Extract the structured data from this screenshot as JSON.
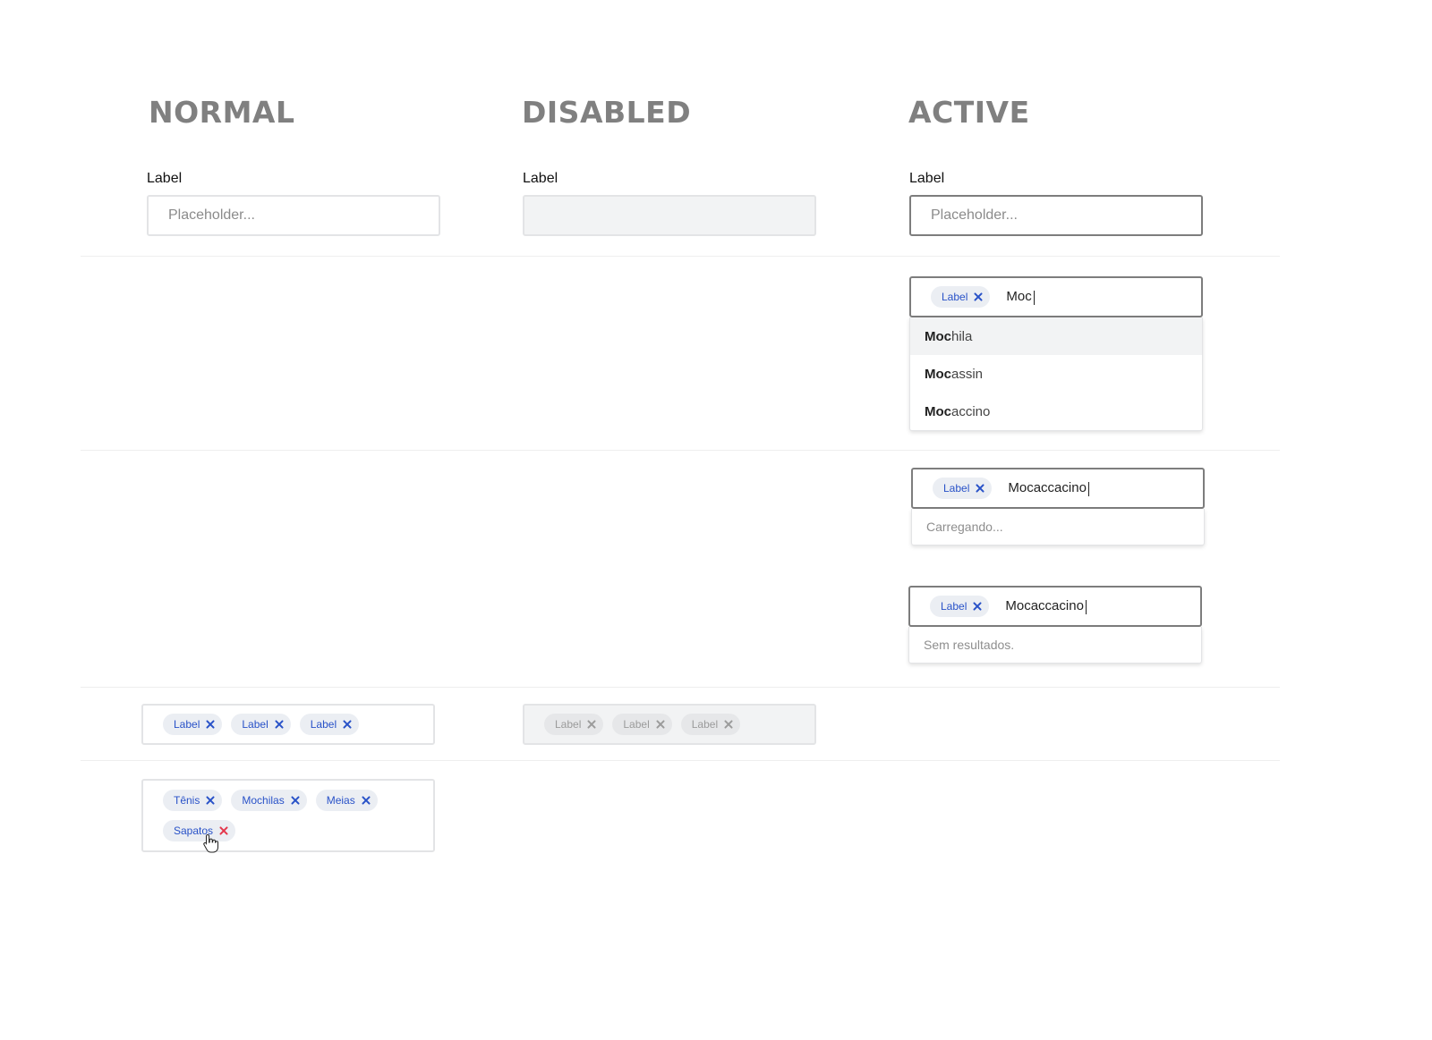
{
  "headings": {
    "normal": "NORMAL",
    "disabled": "DISABLED",
    "active": "ACTIVE"
  },
  "fields": {
    "normal": {
      "label": "Label",
      "placeholder": "Placeholder..."
    },
    "disabled": {
      "label": "Label",
      "placeholder": ""
    },
    "active": {
      "label": "Label",
      "placeholder": "Placeholder..."
    }
  },
  "autocomplete": {
    "chip": "Label",
    "typed": "Moc",
    "match": "Moc",
    "options": [
      {
        "match": "Moc",
        "rest": "hila"
      },
      {
        "match": "Moc",
        "rest": "assin"
      },
      {
        "match": "Moc",
        "rest": "accino"
      }
    ]
  },
  "loading": {
    "chip": "Label",
    "typed": "Mocaccacino",
    "status": "Carregando..."
  },
  "no_results": {
    "chip": "Label",
    "typed": "Mocaccacino",
    "status": "Sem resultados."
  },
  "tags_normal": [
    "Label",
    "Label",
    "Label"
  ],
  "tags_disabled": [
    "Label",
    "Label",
    "Label"
  ],
  "tags_multi": [
    "Tênis",
    "Mochilas",
    "Meias",
    "Sapatos"
  ],
  "colors": {
    "chip_text": "#2952c8",
    "chip_bg": "#ebeef3",
    "remove_hover": "#e4364b",
    "heading": "#808080"
  },
  "icons": {
    "remove": "close-icon",
    "cursor": "hand-pointer-icon"
  }
}
